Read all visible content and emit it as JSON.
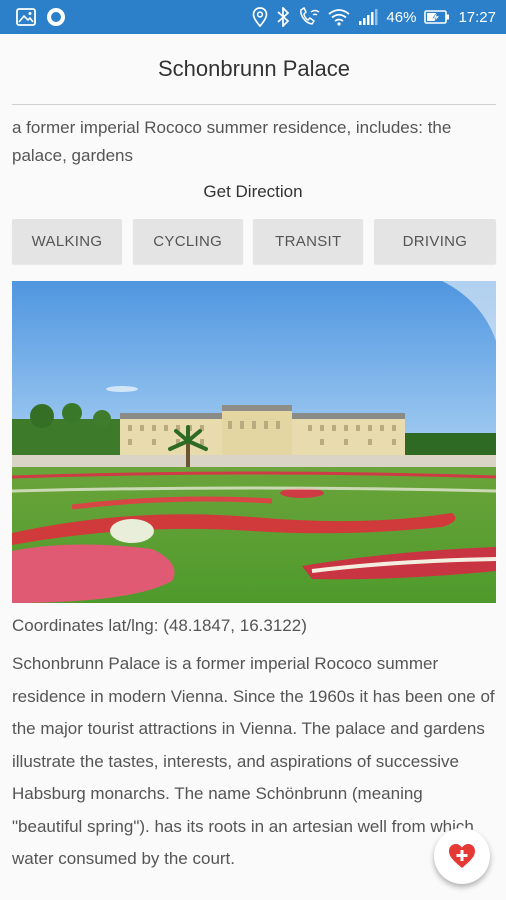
{
  "status_bar": {
    "battery": "46%",
    "time": "17:27",
    "left_icons": [
      "image-icon",
      "circle-notification-icon"
    ],
    "right_icons": [
      "location-icon",
      "bluetooth-icon",
      "call-wifi-icon",
      "wifi-icon",
      "signal-icon",
      "battery-charging-icon"
    ],
    "background_color": "#2b80c9"
  },
  "header": {
    "title": "Schonbrunn Palace"
  },
  "summary": "a former imperial Rococo summer residence, includes: the palace, gardens",
  "directions": {
    "heading": "Get Direction",
    "buttons": [
      "WALKING",
      "CYCLING",
      "TRANSIT",
      "DRIVING"
    ]
  },
  "photo": {
    "subject": "schonbrunn-palace-photo"
  },
  "coordinates_text": "Coordinates lat/lng: (48.1847, 16.3122)",
  "description": "Schonbrunn Palace is a former imperial Rococo summer residence in modern Vienna. Since the 1960s it has been one of the major tourist attractions in Vienna. The palace and gardens illustrate the tastes, interests, and aspirations of successive Habsburg monarchs. The name Schönbrunn (meaning \"beautiful spring\"). has its roots in an artesian well from which water consumed by the court.",
  "fab": {
    "icon": "add-favorite-heart-icon",
    "color": "#e53935"
  }
}
